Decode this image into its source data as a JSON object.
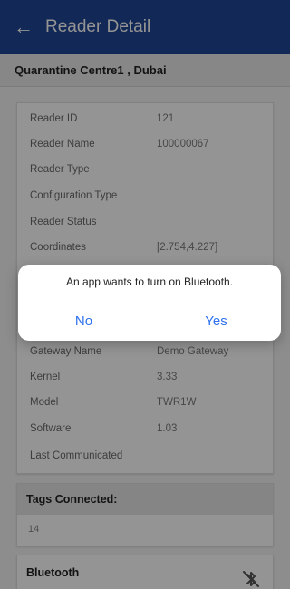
{
  "appbar": {
    "title": "Reader Detail"
  },
  "location": {
    "name": "Quarantine Centre1 , Dubai"
  },
  "details": [
    {
      "label": "Reader ID",
      "value": "121"
    },
    {
      "label": "Reader Name",
      "value": "100000067"
    },
    {
      "label": "Reader Type",
      "value": ""
    },
    {
      "label": "Configuration Type",
      "value": ""
    },
    {
      "label": "Reader Status",
      "value": ""
    },
    {
      "label": "Coordinates",
      "value": "[2.754,4.227]"
    },
    {
      "label": "Gateway Name",
      "value": "Demo Gateway"
    },
    {
      "label": "Kernel",
      "value": "3.33"
    },
    {
      "label": "Model",
      "value": "TWR1W"
    },
    {
      "label": "Software",
      "value": "1.03"
    },
    {
      "label": "Last Communicated",
      "value": ""
    }
  ],
  "tags": {
    "title": "Tags Connected:",
    "count": "14"
  },
  "bluetooth": {
    "title": "Bluetooth",
    "icon": "bluetooth-off-icon"
  },
  "dialog": {
    "message": "An app wants to turn on Bluetooth.",
    "no_label": "No",
    "yes_label": "Yes"
  },
  "colors": {
    "appbar": "#1f4597",
    "dialog_action": "#2f72ef"
  }
}
